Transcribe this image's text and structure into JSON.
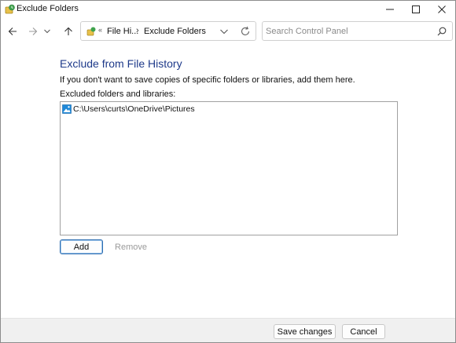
{
  "window": {
    "title": "Exclude Folders",
    "caption_buttons": [
      "minimize-icon",
      "maximize-icon",
      "close-icon"
    ]
  },
  "navigation": {
    "buttons": [
      "back-arrow-icon",
      "forward-arrow-icon",
      "chevron-down-icon",
      "up-arrow-icon"
    ],
    "address": {
      "overflow": "«",
      "crumbs": [
        "File Hi...",
        "Exclude Folders"
      ],
      "separator": "›"
    },
    "search": {
      "placeholder": "Search Control Panel",
      "value": ""
    }
  },
  "main": {
    "heading": "Exclude from File History",
    "description": "If you don't want to save copies of specific folders or libraries, add them here.",
    "list_label": "Excluded folders and libraries:",
    "excluded_items": [
      {
        "path": "C:\\Users\\curts\\OneDrive\\Pictures",
        "icon": "pictures-library-icon"
      }
    ],
    "add_label": "Add",
    "remove_label": "Remove"
  },
  "footer": {
    "save_label": "Save changes",
    "cancel_label": "Cancel"
  },
  "colors": {
    "heading": "#1e3a8a",
    "accent_border": "#2b6cb0",
    "footer_bg": "#f0f0f0",
    "disabled_text": "#9a9a9a"
  }
}
